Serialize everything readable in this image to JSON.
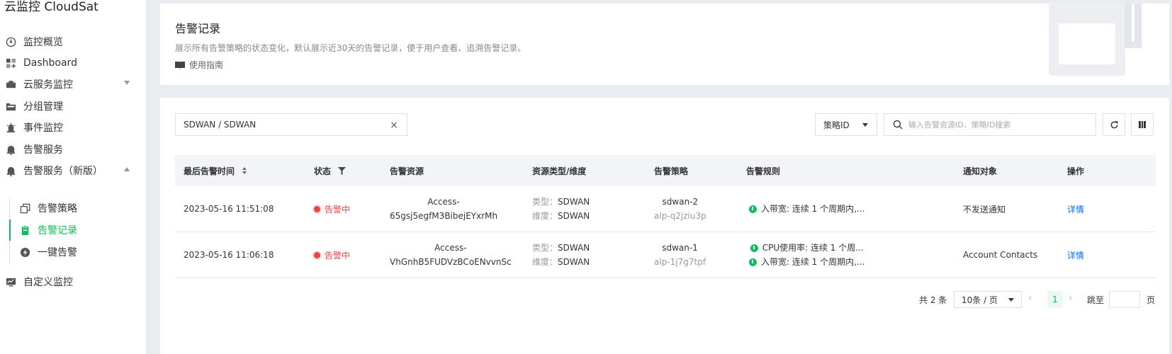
{
  "app": {
    "title": "云监控 CloudSat"
  },
  "sidebar": {
    "items": [
      {
        "label": "监控概览",
        "icon": "dashboard-gauge-icon"
      },
      {
        "label": "Dashboard",
        "icon": "grid-plus-icon"
      },
      {
        "label": "云服务监控",
        "icon": "cloud-icon"
      },
      {
        "label": "分组管理",
        "icon": "folder-icon"
      },
      {
        "label": "事件监控",
        "icon": "alarm-light-icon"
      },
      {
        "label": "告警服务",
        "icon": "bell-icon"
      },
      {
        "label": "告警服务（新版）",
        "icon": "bell-icon"
      },
      {
        "label": "自定义监控",
        "icon": "monitor-icon"
      }
    ],
    "sub_items": [
      {
        "label": "告警策略",
        "icon": "copy-icon"
      },
      {
        "label": "告警记录",
        "icon": "clipboard-icon",
        "active": true
      },
      {
        "label": "一键告警",
        "icon": "lightning-icon"
      }
    ]
  },
  "header": {
    "title": "告警记录",
    "description": "展示所有告警策略的状态变化，默认展示近30天的告警记录，便于用户查看、追溯告警记录。",
    "guide_link": "使用指南"
  },
  "toolbar": {
    "filter_tag": "SDWAN / SDWAN",
    "clear_symbol": "×",
    "select_value": "策略ID",
    "search_placeholder": "输入告警资源ID、策略ID搜索"
  },
  "table": {
    "columns": [
      "最后告警时间",
      "状态",
      "告警资源",
      "资源类型/维度",
      "告警策略",
      "告警规则",
      "通知对象",
      "操作"
    ],
    "type_label": "类型：",
    "dim_label": "维度：",
    "rows": [
      {
        "time": "2023-05-16 11:51:08",
        "status": "告警中",
        "resource_line1": "Access-",
        "resource_line2": "65gsj5egfM3BibejEYxrMh",
        "type": "SDWAN",
        "dimension": "SDWAN",
        "policy_name": "sdwan-2",
        "policy_id": "alp-q2jziu3p",
        "rules": [
          "入带宽: 连续 1 个周期内,..."
        ],
        "notify": "不发送通知",
        "action": "详情"
      },
      {
        "time": "2023-05-16 11:06:18",
        "status": "告警中",
        "resource_line1": "Access-",
        "resource_line2": "VhGnhB5FUDVzBCoENvvnSc",
        "type": "SDWAN",
        "dimension": "SDWAN",
        "policy_name": "sdwan-1",
        "policy_id": "alp-1j7g7tpf",
        "rules": [
          "CPU使用率: 连续 1 个周...",
          "入带宽: 连续 1 个周期内,..."
        ],
        "notify": "Account Contacts",
        "action": "详情"
      }
    ]
  },
  "pagination": {
    "total": "共 2 条",
    "page_size": "10条 / 页",
    "current_page": "1",
    "jump_label": "跳至",
    "page_unit": "页"
  },
  "colors": {
    "accent": "#0abf5b",
    "alert": "#e54545",
    "link": "#006eff"
  }
}
